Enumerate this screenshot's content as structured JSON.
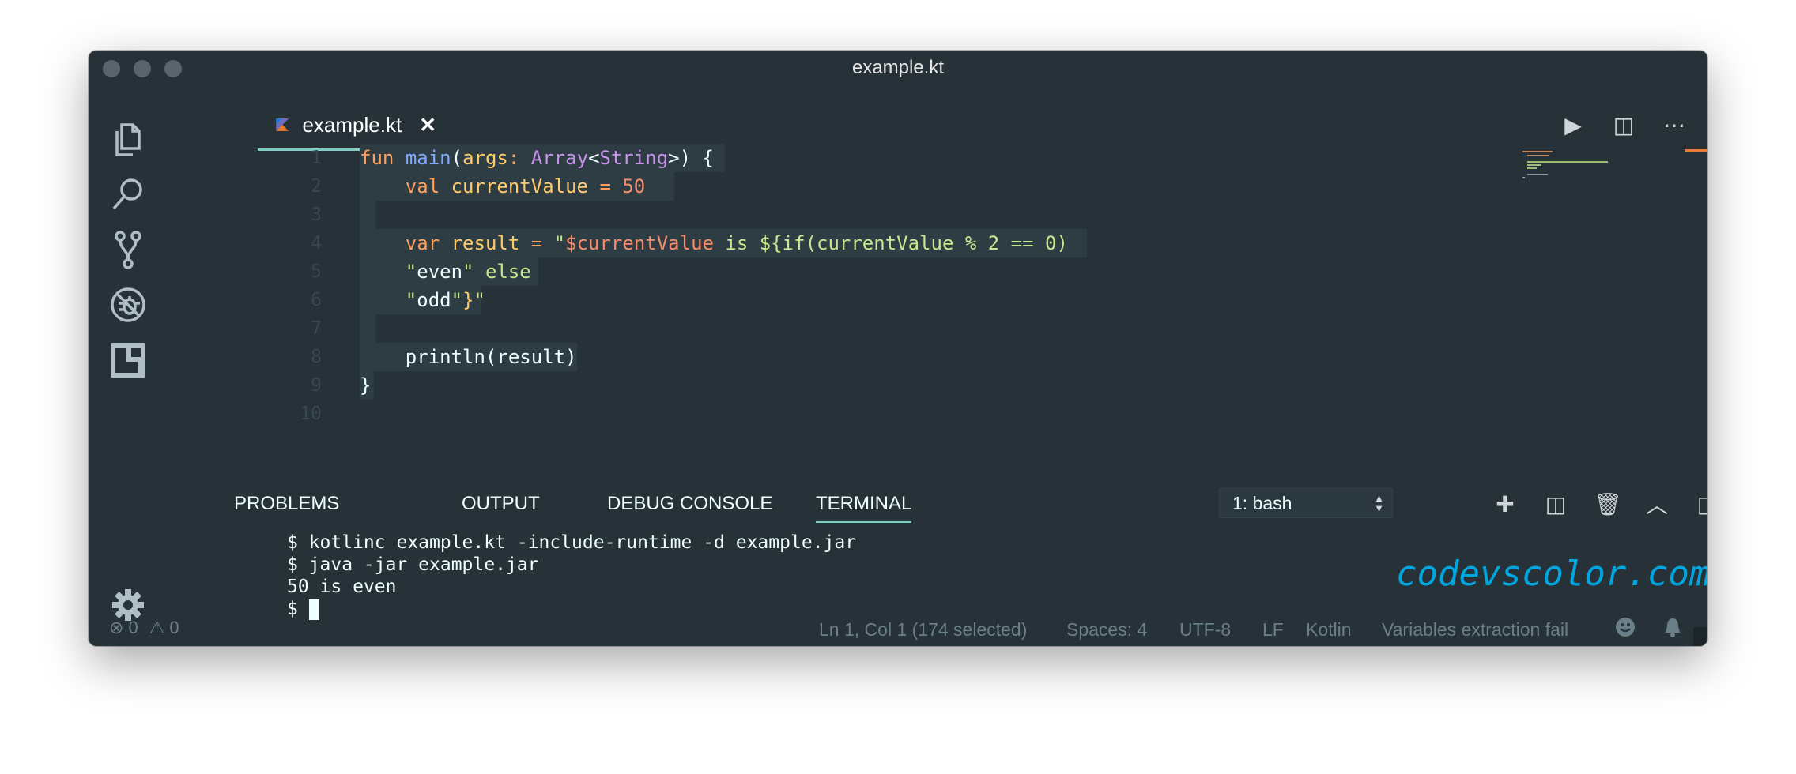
{
  "window": {
    "title": "example.kt"
  },
  "tab": {
    "label": "example.kt",
    "close": "✕"
  },
  "editor": {
    "line_numbers": [
      "1",
      "2",
      "3",
      "4",
      "5",
      "6",
      "7",
      "8",
      "9",
      "10"
    ]
  },
  "panel": {
    "tabs": [
      "PROBLEMS",
      "OUTPUT",
      "DEBUG CONSOLE",
      "TERMINAL"
    ],
    "active_tab": "TERMINAL",
    "terminal_select": "1: bash",
    "terminal_lines": [
      "$ kotlinc example.kt -include-runtime -d example.jar",
      "$ java -jar example.jar",
      "50 is even",
      "$ "
    ]
  },
  "watermark": "codevscolor.com",
  "statusbar": {
    "errors": "0",
    "warnings": "0",
    "position": "Ln 1, Col 1 (174 selected)",
    "spaces": "Spaces: 4",
    "encoding": "UTF-8",
    "eol": "LF",
    "language": "Kotlin",
    "message": "Variables extraction fail"
  },
  "icons": {
    "activity": [
      "files-icon",
      "search-icon",
      "source-control-icon",
      "debug-icon",
      "extensions-icon",
      "gear-icon"
    ],
    "editor_actions": [
      "run-icon",
      "split-editor-icon",
      "more-icon"
    ],
    "panel_actions": [
      "add-terminal-icon",
      "split-terminal-icon",
      "trash-icon",
      "maximize-icon",
      "toggle-panel-icon",
      "close-panel-icon"
    ]
  },
  "colors": {
    "background": "#263238",
    "accent": "#80cbc4",
    "keyword": "#ff9f5a",
    "string": "#c3e88d",
    "type": "#c792ea",
    "function": "#82aaff"
  }
}
